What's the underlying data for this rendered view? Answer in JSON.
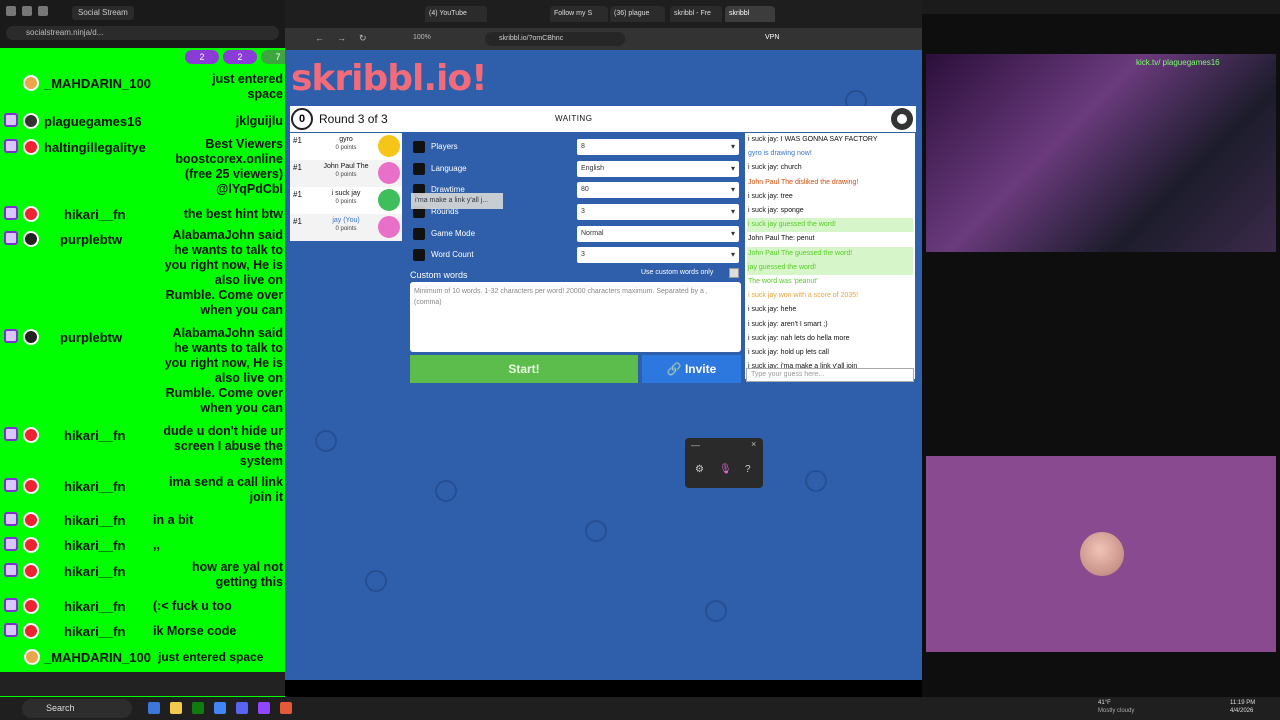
{
  "left_chat": {
    "tab_label": "Social Stream",
    "url": "socialstream.ninja/d...",
    "badge_counts": [
      "2",
      "2",
      "7"
    ],
    "messages": [
      {
        "name": "_MAHDARIN_100",
        "text": "just entered space"
      },
      {
        "name": "plaguegames16",
        "text": "jklguijlu"
      },
      {
        "name": "haltingillegalitye",
        "text": "Best Viewers boostcorex.online (free 25 viewers) @lYqPdCbl"
      },
      {
        "name": "hikari__fn",
        "text": "the best hint btw"
      },
      {
        "name": "purplebtw",
        "text": "AlabamaJohn said he wants to talk to you right now, He is also live on Rumble. Come over when you can"
      },
      {
        "name": "purplebtw",
        "text": "AlabamaJohn said he wants to talk to you right now, He is also live on Rumble. Come over when you can"
      },
      {
        "name": "hikari__fn",
        "text": "dude u don't hide ur screen I abuse the system"
      },
      {
        "name": "hikari__fn",
        "text": "ima send a call link join it"
      },
      {
        "name": "hikari__fn",
        "text": "in a bit"
      },
      {
        "name": "hikari__fn",
        "text": ",,"
      },
      {
        "name": "hikari__fn",
        "text": "how are yal not getting this"
      },
      {
        "name": "hikari__fn",
        "text": "(:< fuck u too"
      },
      {
        "name": "hikari__fn",
        "text": "ik Morse code"
      },
      {
        "name": "_MAHDARIN_100",
        "text": "just entered space"
      }
    ]
  },
  "browser": {
    "tabs": [
      "(4) YouTube",
      "Follow my S",
      "(36) plague",
      "skribbl - Fre",
      "skribbl"
    ],
    "url": "skribbl.io/?omCBhnc",
    "zoom": "100%",
    "vpn": "VPN"
  },
  "game": {
    "logo": "skribbl.io!",
    "round_number": "0",
    "round_text": "Round 3 of 3",
    "status": "WAITING",
    "players": [
      {
        "rank": "#1",
        "name": "gyro",
        "points": "0 points",
        "face_color": "#f5c518"
      },
      {
        "rank": "#1",
        "name": "John Paul The",
        "points": "0 points",
        "face_color": "#e870c8"
      },
      {
        "rank": "#1",
        "name": "i suck jay",
        "points": "0 points",
        "face_color": "#3fbf5b"
      },
      {
        "rank": "#1",
        "name": "jay (You)",
        "points": "0 points",
        "face_color": "#e870c8"
      }
    ],
    "settings": [
      {
        "label": "Players",
        "value": "8"
      },
      {
        "label": "Language",
        "value": "English"
      },
      {
        "label": "Drawtime",
        "value": "80"
      },
      {
        "label": "Rounds",
        "value": "3"
      },
      {
        "label": "Game Mode",
        "value": "Normal"
      },
      {
        "label": "Word Count",
        "value": "3"
      }
    ],
    "tooltip": "i'ma make a link y'all j...",
    "custom_words_label": "Custom words",
    "use_custom_words_label": "Use custom words only",
    "custom_words_placeholder": "Minimum of 10 words. 1-32 characters per word! 20000 characters maximum. Separated by a , (comma)",
    "start_label": "Start!",
    "invite_label": "Invite",
    "chat": [
      {
        "text": "i suck jay: I WAS GONNA SAY FACTORY",
        "color": "#111111",
        "bg": "#ffffff"
      },
      {
        "text": "gyro is drawing now!",
        "color": "#3975ce",
        "bg": "#ffffff"
      },
      {
        "text": "i suck jay: church",
        "color": "#111111",
        "bg": "#ffffff"
      },
      {
        "text": "John Paul The disliked the drawing!",
        "color": "#ce4f0a",
        "bg": "#ffffff"
      },
      {
        "text": "i suck jay: tree",
        "color": "#111111",
        "bg": "#ffffff"
      },
      {
        "text": "i suck jay: sponge",
        "color": "#111111",
        "bg": "#ffffff"
      },
      {
        "text": "i suck jay guessed the word!",
        "color": "#56ce27",
        "bg": "#d6f5c8"
      },
      {
        "text": "John Paul The: penut",
        "color": "#111111",
        "bg": "#ffffff"
      },
      {
        "text": "John Paul The guessed the word!",
        "color": "#56ce27",
        "bg": "#d6f5c8"
      },
      {
        "text": "jay guessed the word!",
        "color": "#56ce27",
        "bg": "#d6f5c8"
      },
      {
        "text": "The word was 'peanut'",
        "color": "#56ce27",
        "bg": "#ffffff"
      },
      {
        "text": "i suck jay won with a score of 2035!",
        "color": "#e8a33a",
        "bg": "#ffffff"
      },
      {
        "text": "i suck jay: hehe",
        "color": "#111111",
        "bg": "#ffffff"
      },
      {
        "text": "i suck jay: aren't I smart ;)",
        "color": "#111111",
        "bg": "#ffffff"
      },
      {
        "text": "i suck jay: nah lets do hella more",
        "color": "#111111",
        "bg": "#ffffff"
      },
      {
        "text": "i suck jay: hold up lets call",
        "color": "#111111",
        "bg": "#ffffff"
      },
      {
        "text": "i suck jay: i'ma make a link y'all join",
        "color": "#111111",
        "bg": "#ffffff"
      }
    ],
    "guess_placeholder": "Type your guess here..."
  },
  "right": {
    "cam_overlay": "kick.tv/ plaguegames16"
  },
  "taskbar": {
    "search": "Search",
    "weather_temp": "41°F",
    "weather_text": "Mostly cloudy",
    "time": "11:19 PM",
    "date": "4/4/2026"
  },
  "colors": {
    "chat_green": "#00ff00",
    "skribbl_blue": "#2f5fab",
    "start_green": "#5dbd4c",
    "invite_blue": "#2d78de"
  }
}
